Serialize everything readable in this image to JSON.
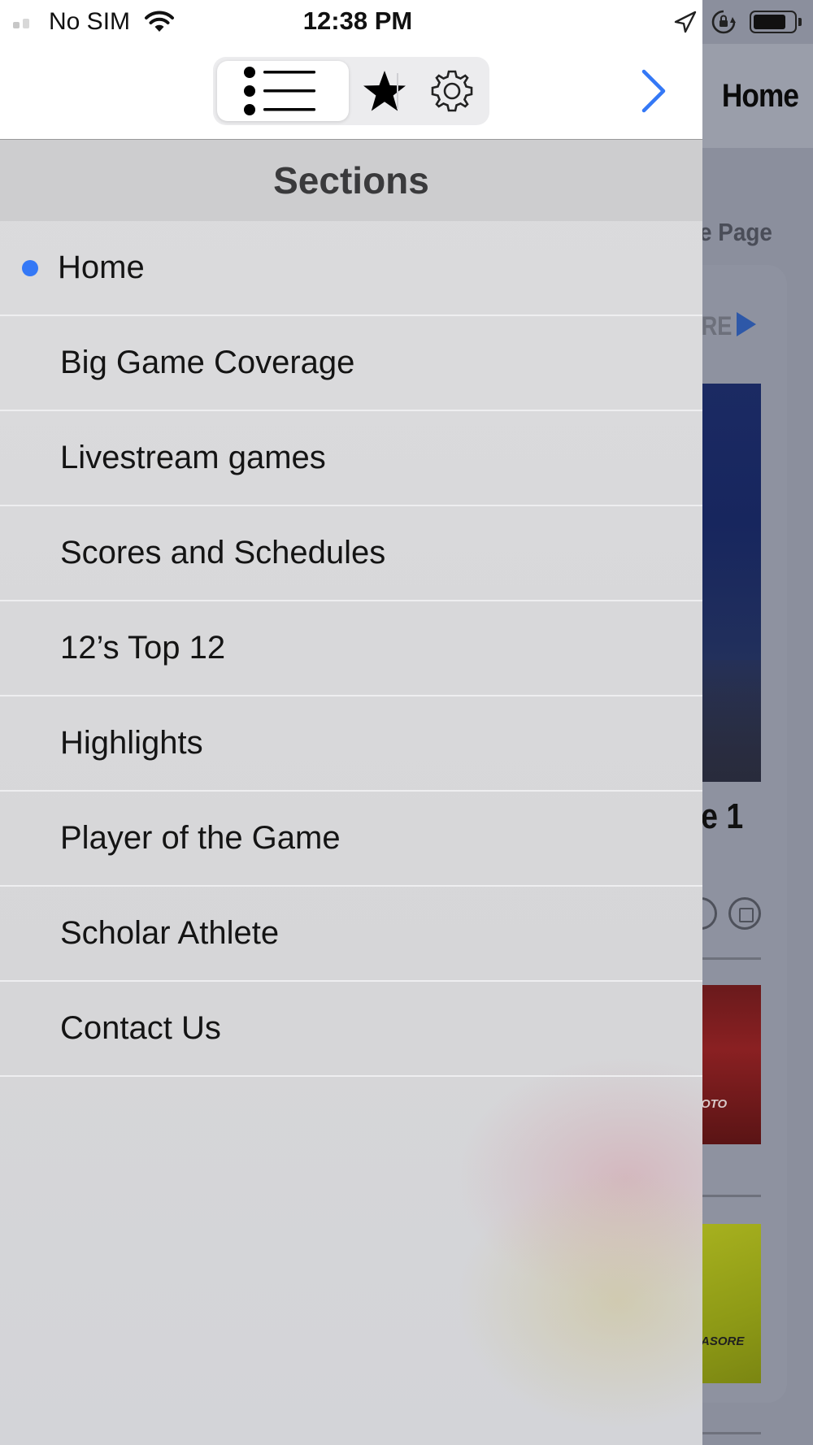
{
  "status_bar": {
    "carrier": "No SIM",
    "time": "12:38 PM",
    "icons": [
      "signal-icon",
      "wifi-icon",
      "location-icon",
      "rotation-lock-icon",
      "battery-icon"
    ]
  },
  "drawer": {
    "tabs": [
      {
        "name": "sections",
        "icon": "list-icon",
        "selected": true
      },
      {
        "name": "favorites",
        "icon": "star-icon",
        "selected": false
      },
      {
        "name": "settings",
        "icon": "gear-icon",
        "selected": false
      }
    ],
    "forward_icon": "chevron-right-icon",
    "header": "Sections",
    "items": [
      {
        "label": "Home",
        "active": true
      },
      {
        "label": "Big Game Coverage",
        "active": false
      },
      {
        "label": "Livestream games",
        "active": false
      },
      {
        "label": "Scores and Schedules",
        "active": false
      },
      {
        "label": "12’s Top 12",
        "active": false
      },
      {
        "label": "Highlights",
        "active": false
      },
      {
        "label": "Player of the Game",
        "active": false
      },
      {
        "label": "Scholar Athlete",
        "active": false
      },
      {
        "label": "Contact Us",
        "active": false
      }
    ]
  },
  "background_page": {
    "title": "Home",
    "partial_subtitle": "e Page",
    "partial_more_label": "RE",
    "partial_headline": "e 1",
    "partial_thumb_label_1": "OTO",
    "partial_thumb_label_2": "ASORE"
  },
  "colors": {
    "accent": "#3478f6",
    "chevron": "#3478f6",
    "drawer_bg": "#d8d8da",
    "header_bg": "#cdcdcf"
  }
}
